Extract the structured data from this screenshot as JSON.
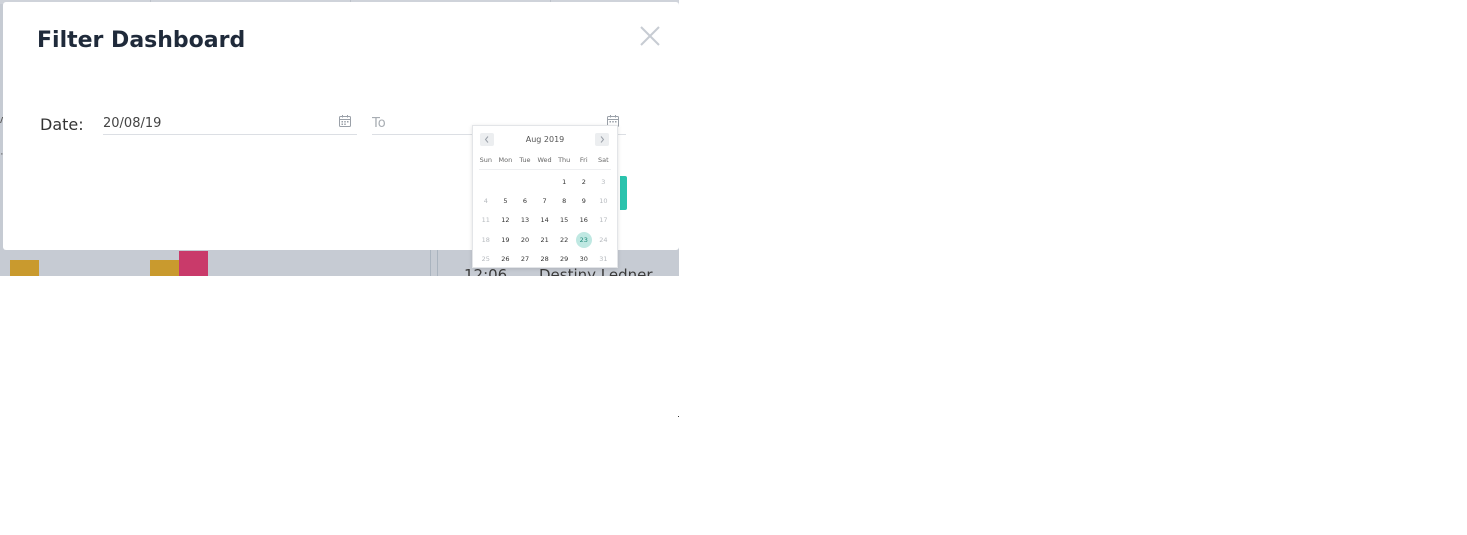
{
  "modal": {
    "title": "Filter Dashboard",
    "close_icon": "close-icon"
  },
  "filter": {
    "date_label": "Date:",
    "from_value": "20/08/19",
    "to_placeholder": "To",
    "calendar_icon": "calendar-icon"
  },
  "calendar": {
    "month_label": "Aug 2019",
    "prev_icon": "chevron-left-icon",
    "next_icon": "chevron-right-icon",
    "weekdays": [
      "Sun",
      "Mon",
      "Tue",
      "Wed",
      "Thu",
      "Fri",
      "Sat"
    ],
    "weeks": [
      [
        "",
        "",
        "",
        "",
        "1",
        "2",
        "3"
      ],
      [
        "4",
        "5",
        "6",
        "7",
        "8",
        "9",
        "10"
      ],
      [
        "11",
        "12",
        "13",
        "14",
        "15",
        "16",
        "17"
      ],
      [
        "18",
        "19",
        "20",
        "21",
        "22",
        "23",
        "24"
      ],
      [
        "25",
        "26",
        "27",
        "28",
        "29",
        "30",
        "31"
      ]
    ],
    "selected_day": "23",
    "disabled_days": [
      "3",
      "4",
      "10",
      "11",
      "17",
      "18",
      "24",
      "25",
      "31"
    ]
  },
  "background": {
    "row_time": "12:06",
    "row_name": "Destiny Ledner",
    "colors": {
      "mustard": "#c99a2e",
      "magenta": "#c93a6a",
      "teal": "#2bc3ad"
    }
  }
}
